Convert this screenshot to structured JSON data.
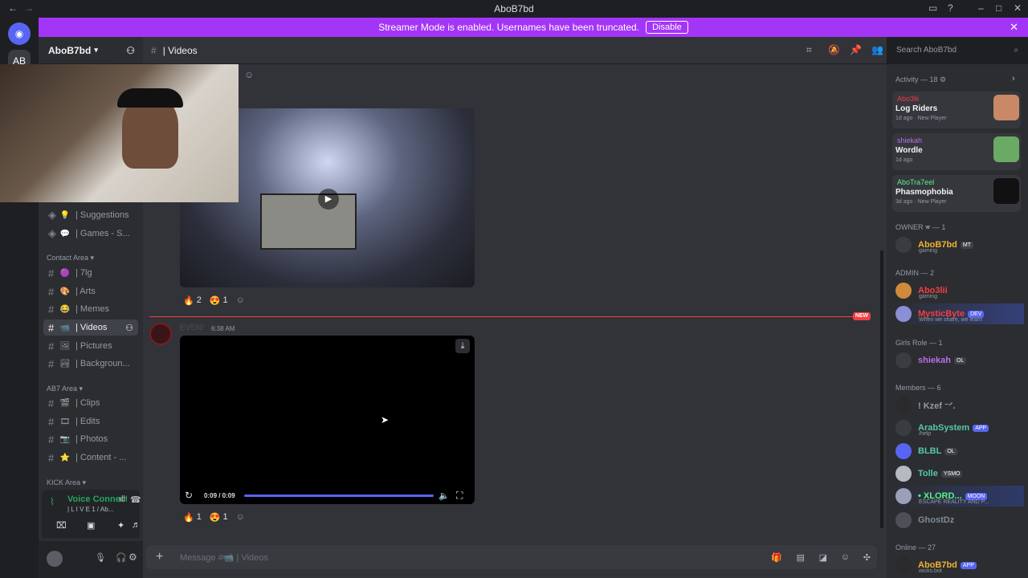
{
  "window": {
    "title": "AboB7bd",
    "back": "←",
    "forward": "→"
  },
  "banner": {
    "text": "Streamer Mode is enabled. Usernames have been truncated.",
    "button": "Disable"
  },
  "server": {
    "name": "AboB7bd"
  },
  "header": {
    "channel": "| Videos",
    "search_placeholder": "Search AboB7bd"
  },
  "sidebar": {
    "channels": [
      {
        "emoji": "💡",
        "label": "| Suggestions"
      },
      {
        "emoji": "💬",
        "label": "| Games - S..."
      }
    ],
    "contact_area": "Contact Area",
    "contact": [
      {
        "emoji": "🟣",
        "label": "| 7lg"
      },
      {
        "emoji": "🎨",
        "label": "| Arts"
      },
      {
        "emoji": "😂",
        "label": "| Memes"
      },
      {
        "emoji": "📹",
        "label": "| Videos"
      },
      {
        "emoji": "🖼",
        "label": "| Pictures"
      },
      {
        "emoji": "🏞",
        "label": "| Backgroun..."
      }
    ],
    "ab7_area": "AB7 Area",
    "ab7": [
      {
        "emoji": "🎬",
        "label": "| Clips"
      },
      {
        "emoji": "🎞",
        "label": "| Edits"
      },
      {
        "emoji": "📷",
        "label": "| Photos"
      },
      {
        "emoji": "⭐",
        "label": "| Content - ..."
      }
    ],
    "kick_area": "KICK Area",
    "voice": {
      "status": "Voice Connected",
      "channel": "| L I V E 1 / Ab..."
    }
  },
  "messages": {
    "reactions1": [
      {
        "emoji": "🔥",
        "count": "2"
      },
      {
        "emoji": "😍",
        "count": "1"
      }
    ],
    "author": "EVEN!",
    "time": "6:38 AM",
    "new_tag": "NEW",
    "video_time": "0:09 / 0:09",
    "reactions2": [
      {
        "emoji": "🔥",
        "count": "1"
      },
      {
        "emoji": "😍",
        "count": "1"
      }
    ]
  },
  "composer": {
    "placeholder": "Message #📹 | Videos"
  },
  "members": {
    "activity_header": "Activity — 18",
    "activities": [
      {
        "user": "Abo3lii",
        "game": "Log Riders",
        "meta": "1d ago  ·  New Player",
        "color": "#f23f43"
      },
      {
        "user": "shiekah",
        "game": "Wordle",
        "meta": "1d ago",
        "color": "#b96ee8"
      },
      {
        "user": "AboTra7eel",
        "game": "Phasmophobia",
        "meta": "3d ago  ·  New Player",
        "color": "#57f287"
      }
    ],
    "owner_header": "OWNER 🕿 — 1",
    "owner": [
      {
        "name": "AboB7bd",
        "tag": "MT",
        "sub": "gaming",
        "color": "#f0b232"
      }
    ],
    "admin_header": "ADMIN — 2",
    "admins": [
      {
        "name": "Abo3lii",
        "sub": "gaming",
        "color": "#f23f43"
      },
      {
        "name": "MysticByte",
        "tag": "DEV",
        "sub": "When we share, we learn",
        "color": "#f23f43"
      }
    ],
    "girls_header": "Girls Role — 1",
    "girls": [
      {
        "name": "shiekah",
        "tag": "OL",
        "color": "#b96ee8"
      }
    ],
    "members_header": "Members — 6",
    "members": [
      {
        "name": "! Kzef ⁻ᐟ.",
        "color": "#949ba4"
      },
      {
        "name": "ArabSystem",
        "tag": "APP",
        "sub": "/help",
        "color": "#57c7a8"
      },
      {
        "name": "BLBL",
        "tag": "OL",
        "color": "#57c7a8"
      },
      {
        "name": "Tolle",
        "tag": "YSMO",
        "color": "#57c7a8"
      },
      {
        "name": "• XLORD...",
        "tag": "MOON",
        "sub": "ESCAPE REALITY AND P...",
        "color": "#57f287"
      },
      {
        "name": "GhostDz",
        "color": "#7f8a94"
      }
    ],
    "online_header": "Online — 27",
    "online": [
      {
        "name": "AboB7bd",
        "tag": "APP",
        "sub": "wicks.bot",
        "color": "#f0b232"
      }
    ]
  }
}
